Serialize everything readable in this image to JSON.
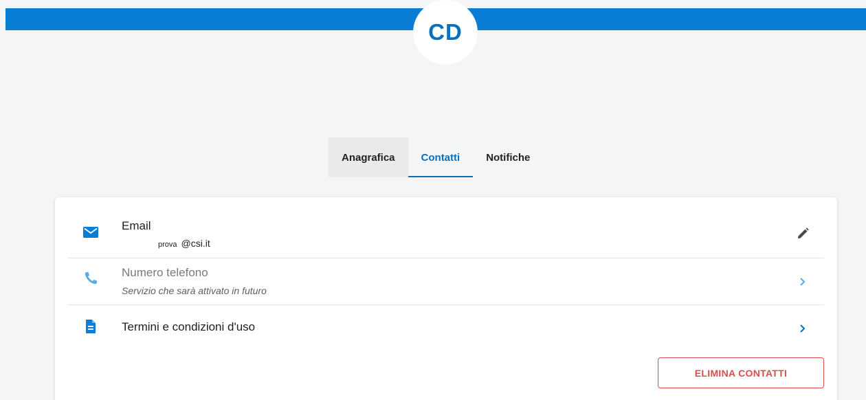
{
  "header": {
    "avatar_initials": "CD",
    "bar_color": "#0a7dd4"
  },
  "tabs": [
    {
      "label": "Anagrafica",
      "state": "hover"
    },
    {
      "label": "Contatti",
      "state": "active"
    },
    {
      "label": "Notifiche",
      "state": "default"
    }
  ],
  "contacts": {
    "email": {
      "title": "Email",
      "value_prefix": "prova",
      "value_domain": "@csi.it",
      "icon": "envelope-icon",
      "action_icon": "pencil-icon"
    },
    "phone": {
      "title": "Numero telefono",
      "subtitle": "Servizio che sarà attivato in futuro",
      "icon": "phone-icon",
      "action_icon": "chevron-right-icon"
    },
    "terms": {
      "title": "Termini e condizioni d'uso",
      "icon": "document-icon",
      "action_icon": "chevron-right-icon"
    },
    "delete_label": "ELIMINA CONTATTI"
  },
  "colors": {
    "accent": "#0a6fbd",
    "danger": "#dd4b4b"
  }
}
